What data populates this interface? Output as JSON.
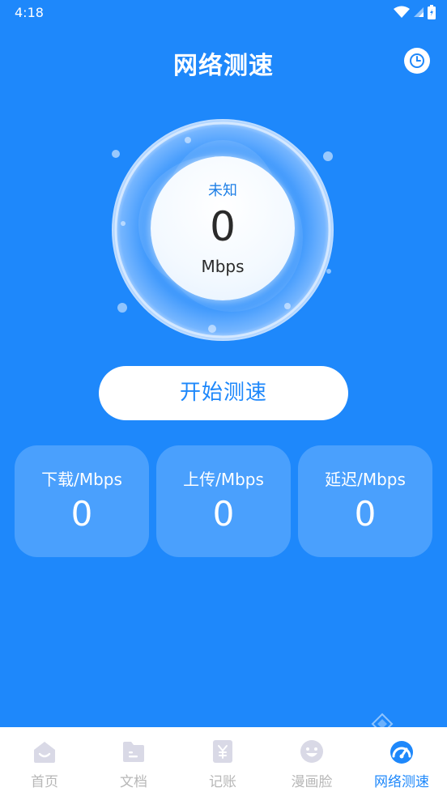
{
  "status_bar": {
    "time": "4:18"
  },
  "header": {
    "title": "网络测速"
  },
  "gauge": {
    "status": "未知",
    "value": "0",
    "unit": "Mbps"
  },
  "start_button": {
    "label": "开始测速"
  },
  "stats": [
    {
      "label": "下载/Mbps",
      "value": "0"
    },
    {
      "label": "上传/Mbps",
      "value": "0"
    },
    {
      "label": "延迟/Mbps",
      "value": "0"
    }
  ],
  "nav": {
    "items": [
      {
        "label": "首页",
        "icon": "home-icon"
      },
      {
        "label": "文档",
        "icon": "document-icon"
      },
      {
        "label": "记账",
        "icon": "accounting-icon"
      },
      {
        "label": "漫画脸",
        "icon": "cartoon-face-icon"
      },
      {
        "label": "网络测速",
        "icon": "speedometer-icon",
        "active": true
      }
    ]
  },
  "colors": {
    "background": "#1e88fb",
    "card": "#4aa0fd",
    "active": "#1e88fb",
    "inactive": "#b7b7b7"
  }
}
